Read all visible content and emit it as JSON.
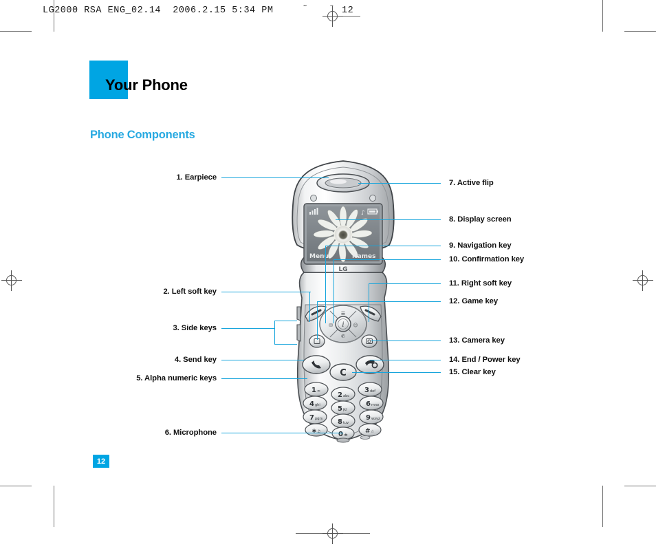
{
  "print_header": {
    "text": "LG2000 RSA ENG_02.14  2006.2.15 5:34 PM",
    "tilde_left": "˜",
    "tilde_right": "˝",
    "folio": "12"
  },
  "chapter": {
    "title": "Your Phone",
    "tab_color": "#00a5e3"
  },
  "section": {
    "title": "Phone Components",
    "color": "#27a9e1"
  },
  "page_footer": {
    "page_number": "12",
    "badge_color": "#00a5e3"
  },
  "callouts": {
    "left": [
      {
        "id": "earpiece",
        "label": "1. Earpiece"
      },
      {
        "id": "left-soft-key",
        "label": "2. Left soft key"
      },
      {
        "id": "side-keys",
        "label": "3. Side keys"
      },
      {
        "id": "send-key",
        "label": "4. Send key"
      },
      {
        "id": "alpha-numeric-keys",
        "label": "5. Alpha numeric keys"
      },
      {
        "id": "microphone",
        "label": "6. Microphone"
      }
    ],
    "right": [
      {
        "id": "active-flip",
        "label": "7. Active flip"
      },
      {
        "id": "display-screen",
        "label": "8. Display screen"
      },
      {
        "id": "navigation-key",
        "label": "9. Navigation key"
      },
      {
        "id": "confirmation-key",
        "label": "10. Confirmation key"
      },
      {
        "id": "right-soft-key",
        "label": "11. Right soft key"
      },
      {
        "id": "game-key",
        "label": "12. Game key"
      },
      {
        "id": "camera-key",
        "label": "13. Camera key"
      },
      {
        "id": "end-power-key",
        "label": "14. End / Power key"
      },
      {
        "id": "clear-key",
        "label": "15. Clear key"
      }
    ],
    "line_color": "#17a5dc"
  },
  "phone": {
    "brand": "LG",
    "display": {
      "signal_icon": "signal-bars-icon",
      "melody_icon": "music-note-icon",
      "battery_icon": "battery-icon",
      "wallpaper": "sunflower-photo",
      "left_softkey_label": "Menu",
      "right_softkey_label": "Names"
    },
    "keypad": {
      "clear_key": "C",
      "keys": [
        {
          "digit": "1",
          "letters": "∞"
        },
        {
          "digit": "2",
          "letters": "abc"
        },
        {
          "digit": "3",
          "letters": "def"
        },
        {
          "digit": "4",
          "letters": "ghi"
        },
        {
          "digit": "5",
          "letters": "jkl"
        },
        {
          "digit": "6",
          "letters": "mno"
        },
        {
          "digit": "7",
          "letters": "pqrs"
        },
        {
          "digit": "8",
          "letters": "tuv"
        },
        {
          "digit": "9",
          "letters": "wxyz"
        },
        {
          "digit": "*",
          "letters": ""
        },
        {
          "digit": "0",
          "letters": "+"
        },
        {
          "digit": "#",
          "letters": ""
        }
      ]
    }
  }
}
